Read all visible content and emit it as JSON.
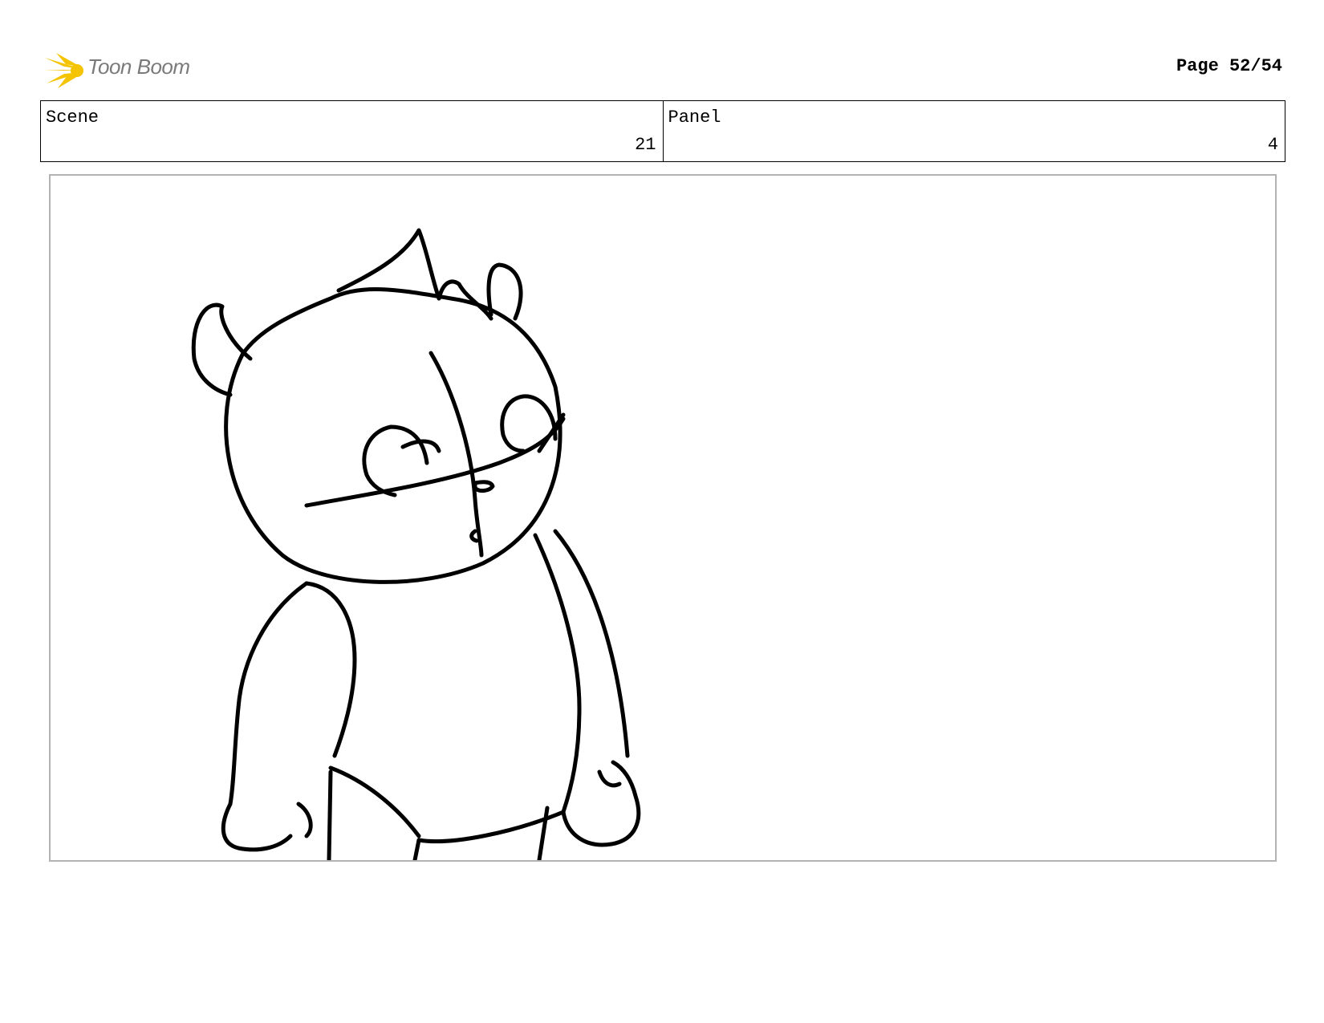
{
  "header": {
    "logo": {
      "brand": "Toon Boom",
      "icon": "toon-boom-burst-icon",
      "accent_color": "#f5c400"
    },
    "page_label": "Page 52/54"
  },
  "info": {
    "scene_label": "Scene",
    "scene_value": "21",
    "panel_label": "Panel",
    "panel_value": "4"
  },
  "panel": {
    "content": "character-sketch",
    "border_color": "#b3b3b3"
  }
}
